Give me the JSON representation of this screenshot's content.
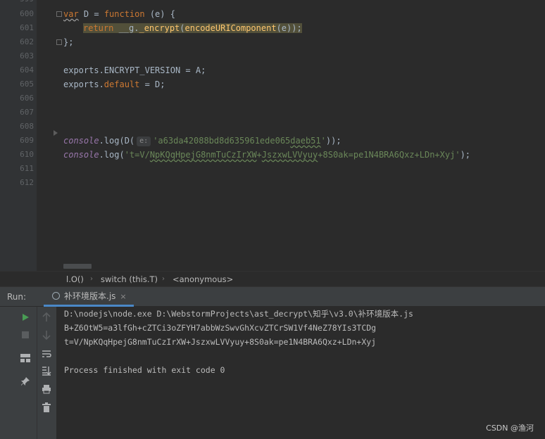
{
  "editor": {
    "line_numbers": [
      "600",
      "601",
      "602",
      "603",
      "604",
      "605",
      "606",
      "607",
      "608",
      "609",
      "610",
      "611",
      "612"
    ],
    "code": {
      "l600": {
        "var": "var",
        "name": " D = ",
        "function": "function",
        "params": " (e) {"
      },
      "l601": {
        "return": "return",
        "call1": " __g.",
        "encrypt": "_encrypt",
        "open": "(",
        "encodeURI": "encodeURIComponent",
        "close": "(e));"
      },
      "l602": {
        "text": "};"
      },
      "l604": {
        "text": "exports.ENCRYPT_VERSION = A;"
      },
      "l605": {
        "exports": "exports.",
        "default": "default",
        "rest": " = D;"
      },
      "l609": {
        "console": "console",
        "dot_log": ".log(D(",
        "hint": "e:",
        "string_a": "'a63da42088bd8d635961ede065",
        "string_b": "daeb51",
        "string_end": "'",
        "close": "));"
      },
      "l610": {
        "console": "console",
        "dot_log": ".log(",
        "s1": "'t=V/",
        "s2": "NpKQqHpejG8nmTuCzIrXW",
        "s3": "+",
        "s4": "JszxwLVVyuy",
        "s5": "+8S0ak=pe1N4BRA6Qxz+LDn+Xyj'",
        "close": ");"
      }
    }
  },
  "breadcrumb": {
    "items": [
      "l.O()",
      "switch (this.T)",
      "<anonymous>"
    ]
  },
  "run_panel": {
    "label": "Run:",
    "tab_label": "补环境版本.js",
    "tab_close": "×",
    "console_lines": [
      "D:\\nodejs\\node.exe D:\\WebstormProjects\\ast_decrypt\\知乎\\v3.0\\补环境版本.js",
      "B+Z6OtW5=a3lfGh+cZTCi3oZFYH7abbWzSwvGhXcvZTCrSW1Vf4NeZ78YIs3TCDg",
      "t=V/NpKQqHpejG8nmTuCzIrXW+JszxwLVVyuy+8S0ak=pe1N4BRA6Qxz+LDn+Xyj",
      "",
      "Process finished with exit code 0"
    ]
  },
  "watermark": "CSDN @渔河",
  "colors": {
    "editor_bg": "#2b2b2b",
    "gutter_bg": "#313335",
    "keyword": "#cc7832",
    "function": "#ffc66d",
    "string": "#6a8759",
    "property": "#9876aa",
    "text": "#a9b7c6",
    "run_green": "#499c54",
    "tab_underline": "#4a88c7"
  }
}
